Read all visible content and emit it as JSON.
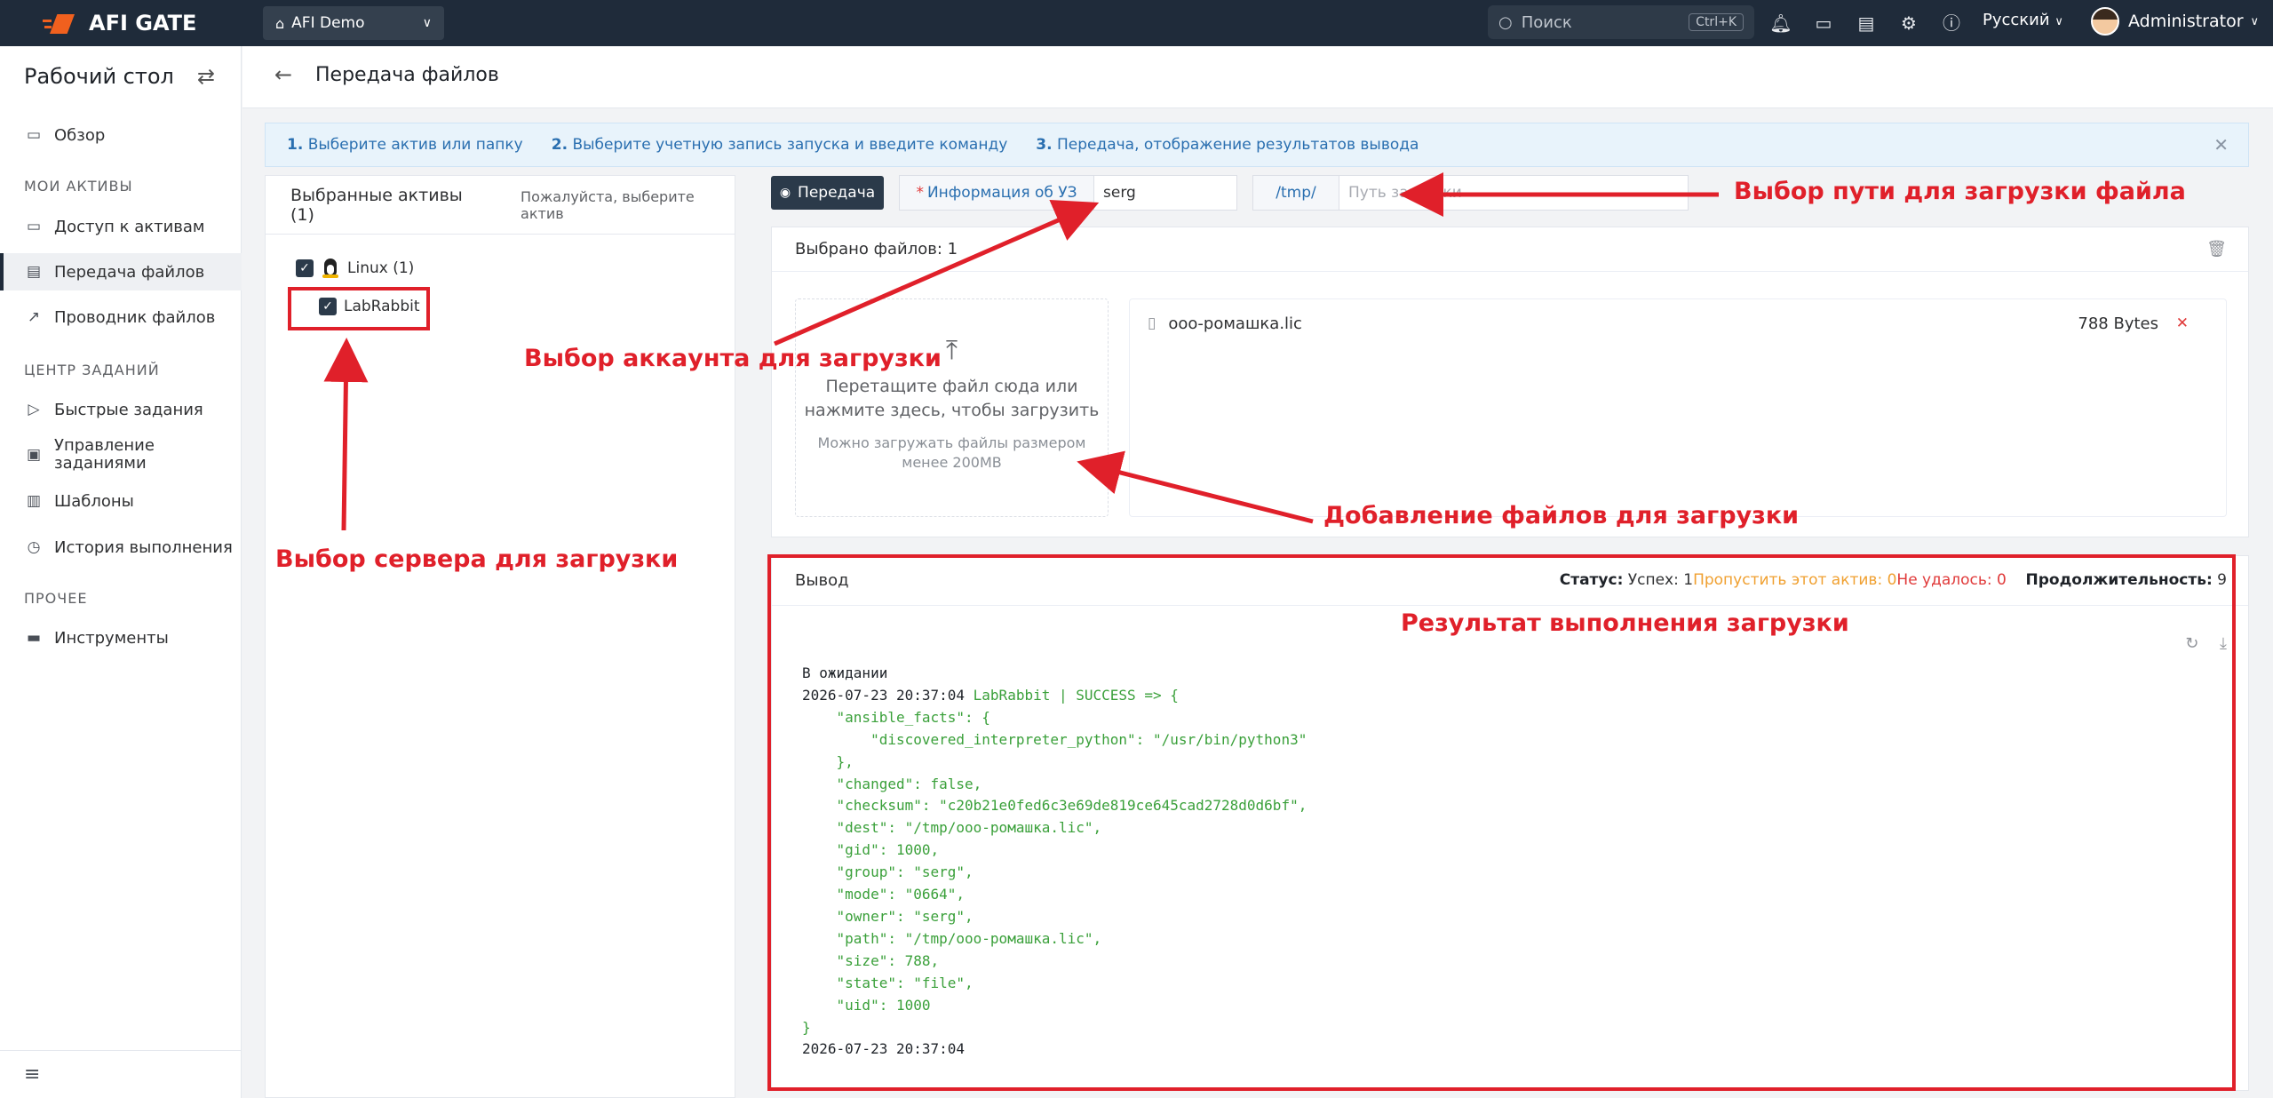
{
  "topbar": {
    "brand": "AFI GATE",
    "org": "AFI Demo",
    "search_placeholder": "Поиск",
    "search_shortcut": "Ctrl+K",
    "language": "Русский",
    "user": "Administrator"
  },
  "sidebar": {
    "title": "Рабочий стол",
    "overview": "Обзор",
    "section_assets": "МОИ АКТИВЫ",
    "asset_access": "Доступ к активам",
    "file_transfer": "Передача файлов",
    "file_explorer": "Проводник файлов",
    "section_jobs": "ЦЕНТР ЗАДАНИЙ",
    "quick_jobs": "Быстрые задания",
    "job_manage_1": "Управление",
    "job_manage_2": "заданиями",
    "templates": "Шаблоны",
    "history": "История выполнения",
    "section_other": "ПРОЧЕЕ",
    "tools": "Инструменты"
  },
  "page": {
    "title": "Передача файлов"
  },
  "steps": {
    "s1_num": "1.",
    "s1": "Выберите актив или папку",
    "s2_num": "2.",
    "s2": "Выберите учетную запись запуска и введите команду",
    "s3_num": "3.",
    "s3": "Передача, отображение результатов вывода"
  },
  "assets": {
    "selected": "Выбранные активы (1)",
    "hint": "Пожалуйста, выберите актив",
    "group": "Linux (1)",
    "host": "LabRabbit"
  },
  "toolbar": {
    "transfer": "Передача",
    "account_label": "Информация об УЗ",
    "account_value": "serg",
    "path_label": "/tmp/",
    "path_placeholder": "Путь загрузки"
  },
  "files": {
    "selected": "Выбрано файлов: 1",
    "drop_line1": "Перетащите файл сюда или",
    "drop_line2": "нажмите здесь, чтобы загрузить",
    "limit_line1": "Можно загружать файлы размером",
    "limit_line2": "менее 200MB",
    "items": [
      {
        "name": "ооо-ромашка.lic",
        "size": "788 Bytes"
      }
    ]
  },
  "output": {
    "title": "Вывод",
    "status_label": "Статус:",
    "success": "Успех: 1",
    "skipped": "Пропустить этот актив: 0",
    "failed": "Не удалось: 0",
    "duration_label": "Продолжительность:",
    "duration": "9",
    "log": [
      {
        "text": "В ожидании",
        "color": "#1f2329"
      },
      {
        "text": "2026-07-23 20:37:04 ",
        "suffix": "LabRabbit | SUCCESS => {"
      },
      {
        "text": "    \"ansible_facts\": {"
      },
      {
        "text": "        \"discovered_interpreter_python\": \"/usr/bin/python3\""
      },
      {
        "text": "    },"
      },
      {
        "text": "    \"changed\": false,"
      },
      {
        "text": "    \"checksum\": \"c20b21e0fed6c3e69de819ce645cad2728d0d6bf\","
      },
      {
        "text": "    \"dest\": \"/tmp/ооо-ромашка.lic\","
      },
      {
        "text": "    \"gid\": 1000,"
      },
      {
        "text": "    \"group\": \"serg\","
      },
      {
        "text": "    \"mode\": \"0664\","
      },
      {
        "text": "    \"owner\": \"serg\","
      },
      {
        "text": "    \"path\": \"/tmp/ооо-ромашка.lic\","
      },
      {
        "text": "    \"size\": 788,"
      },
      {
        "text": "    \"state\": \"file\","
      },
      {
        "text": "    \"uid\": 1000"
      },
      {
        "text": "}"
      },
      {
        "text": "2026-07-23 20:37:04"
      }
    ]
  },
  "annotations": {
    "path": "Выбор пути для загрузки файла",
    "account": "Выбор аккаунта для загрузки",
    "files": "Добавление файлов для загрузки",
    "server": "Выбор сервера для загрузки",
    "result": "Результат выполнения загрузки"
  },
  "colors": {
    "topbar": "#1f2b3a",
    "annotation": "#e0202a",
    "link": "#2a6fb0",
    "log_green": "#3aa03a"
  }
}
